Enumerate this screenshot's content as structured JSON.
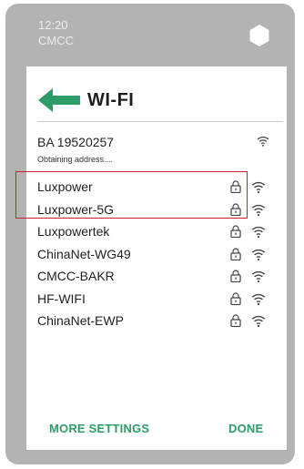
{
  "status_bar": {
    "time": "12:20",
    "carrier": "CMCC"
  },
  "header": {
    "title": "WI-FI"
  },
  "current_network": {
    "ssid": "BA 19520257",
    "status": "Obtaining address...."
  },
  "networks": [
    {
      "name": "Luxpower"
    },
    {
      "name": "Luxpower-5G"
    },
    {
      "name": "Luxpowertek"
    },
    {
      "name": "ChinaNet-WG49"
    },
    {
      "name": "CMCC-BAKR"
    },
    {
      "name": "HF-WIFI"
    },
    {
      "name": "ChinaNet-EWP"
    }
  ],
  "footer": {
    "more_settings": "MORE SETTINGS",
    "done": "DONE"
  },
  "colors": {
    "accent": "#2e9c68",
    "highlight": "#cc1f2f",
    "bezel": "#b3b3b3"
  },
  "icons": {
    "back": "back-arrow-icon",
    "home": "hexagon-home-icon",
    "lock": "lock-icon",
    "signal": "wifi-icon"
  }
}
